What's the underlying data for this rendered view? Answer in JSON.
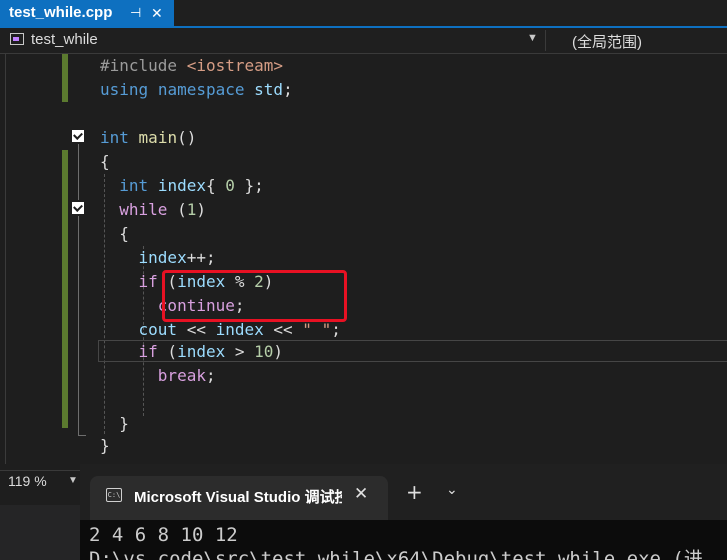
{
  "document_tab": {
    "filename": "test_while.cpp",
    "pin_glyph": "⊣",
    "close_glyph": "✕"
  },
  "navbar": {
    "scope": "test_while",
    "global_scope": "(全局范围)"
  },
  "code": {
    "line1": {
      "directive": "#include",
      "header": "<iostream>"
    },
    "line2": {
      "kw1": "using",
      "kw2": "namespace",
      "name": "std",
      "semi": ";"
    },
    "line4": {
      "type": "int",
      "func": "main",
      "parens": "()"
    },
    "line5": "{",
    "line6": {
      "type": "int",
      "var": "index",
      "brace_open": "{ ",
      "num": "0",
      "rest": " };"
    },
    "line7": {
      "kw": "while",
      "open": " (",
      "num": "1",
      "close": ")"
    },
    "line8": "{",
    "line9": {
      "var": "index",
      "op": "++;"
    },
    "line10": {
      "kw": "if",
      "open": " (",
      "var": "index",
      "op": " % ",
      "num": "2",
      "close": ")"
    },
    "line11": {
      "kw": "continue",
      "semi": ";"
    },
    "line12": {
      "obj": "cout",
      "op1": " << ",
      "var": "index",
      "op2": " << ",
      "str": "\" \"",
      "semi": ";"
    },
    "line13": {
      "kw": "if",
      "open": " (",
      "var": "index",
      "op": " > ",
      "num": "10",
      "close": ")"
    },
    "line14": {
      "kw": "break",
      "semi": ";"
    },
    "line16": "}",
    "line17": "}"
  },
  "statusbar": {
    "zoom": "119 %"
  },
  "console": {
    "tab_title": "Microsoft Visual Studio 调试控制台",
    "icon_text": "C:\\",
    "close_glyph": "✕",
    "new_tab_glyph": "+",
    "dropdown_glyph": "⌄",
    "output_line1": "2 4 6 8 10 12",
    "output_line2": "D:\\vs code\\src\\test_while\\x64\\Debug\\test_while.exe (进"
  }
}
